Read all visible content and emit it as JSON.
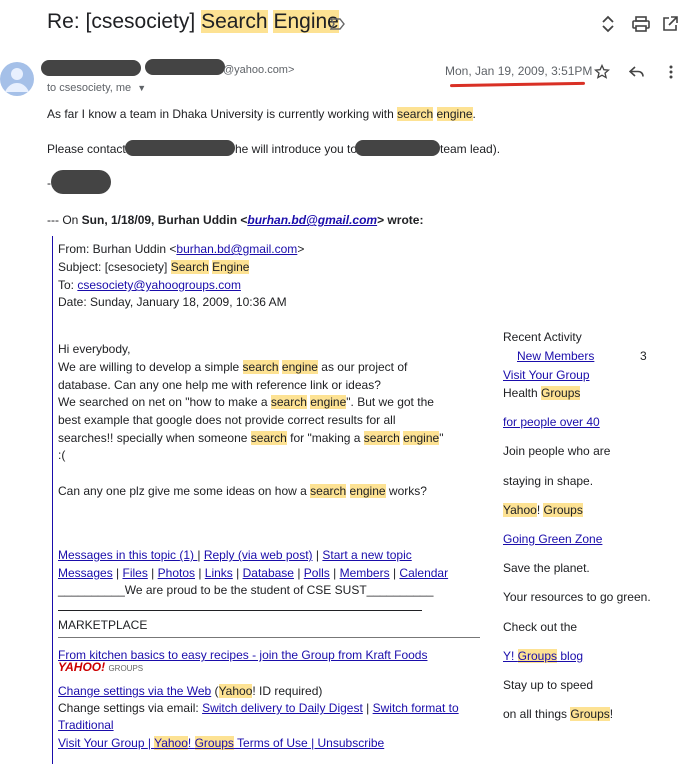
{
  "header": {
    "subject_prefix": "Re: [csesociety] ",
    "subject_hl1": "Search",
    "subject_hl2": "Engine"
  },
  "sender": {
    "email_suffix": "@yahoo.com>",
    "to_line": "to csesociety, me",
    "date": "Mon, Jan 19, 2009, 3:51PM"
  },
  "body": {
    "l1_pre": "As far I know a team in Dhaka University is currently working with ",
    "l1_hl1": "search",
    "l1_hl2": "engine",
    "l1_post": ".",
    "l2_a": "Please contact",
    "l2_b": "he will introduce you to",
    "l2_c": "team lead).",
    "sig": "-",
    "on_line_pre": "--- On ",
    "on_line_date": "Sun, 1/18/09, Burhan Uddin <",
    "on_line_email": "burhan.bd@gmail.com",
    "on_line_post": "> wrote:"
  },
  "quoted": {
    "from_pre": "From: Burhan Uddin <",
    "from_email": "burhan.bd@gmail.com",
    "from_post": ">",
    "subject_pre": "Subject: [csesociety] ",
    "subject_hl1": "Search",
    "subject_hl2": "Engine",
    "to_pre": "To: ",
    "to_email": "csesociety@yahoogroups.com",
    "date": "Date: Sunday, January 18, 2009, 10:36 AM",
    "p1": "Hi everybody,",
    "p2_pre": "We are willing to develop a simple ",
    "p2_hl1": "search",
    "p2_hl2": "engine",
    "p2_post": " as our project of",
    "p3": "database. Can any one help me with reference link or ideas?",
    "p4_pre": "We searched on net on \"how to make a ",
    "p4_hl1": "search",
    "p4_hl2": "engine",
    "p4_post": "\". But we got the",
    "p5": "best example that google does not provide correct results for all",
    "p6_pre": "searches!! specially when someone ",
    "p6_hl1": "search",
    "p6_mid": " for \"making a ",
    "p6_hl2": "search",
    "p6_hl3": "engine",
    "p6_post": "\"",
    "p7": ":(",
    "p8_pre": "Can any one plz give me some ideas on how a ",
    "p8_hl1": "search",
    "p8_hl2": "engine",
    "p8_post": " works?",
    "links1_a": "Messages in this topic ",
    "links1_b": "(1) ",
    "links1_c": "Reply (via web post)",
    "links1_d": " | ",
    "links1_e": "Start a new topic",
    "links2": [
      "Messages",
      "Files",
      "Photos",
      "Links",
      "Database",
      "Polls",
      "Members",
      "Calendar"
    ],
    "proud": "__________We are proud to be the student of CSE SUST__________",
    "marketplace": "MARKETPLACE",
    "kraft": "From kitchen basics to easy recipes - join the Group from Kraft Foods",
    "yahoo_logo": "YAHOO!",
    "yahoo_groups_logo": "GROUPS",
    "change_web": "Change settings via the Web",
    "change_web_post1": " (",
    "change_web_hl": "Yahoo",
    "change_web_post2": "! ID required)",
    "change_email_pre": "Change settings via email: ",
    "switch_daily": "Switch delivery to Daily Digest",
    "switch_sep": " | ",
    "switch_format": "Switch format to",
    "traditional": "Traditional",
    "bottom_visit": "Visit Your Group ",
    "bottom_sep1": "| ",
    "bottom_yahoo": "Yahoo",
    "bottom_excl": "! ",
    "bottom_groups": "Groups",
    "bottom_terms": " Terms of Use ",
    "bottom_sep2": "| ",
    "bottom_unsub": "Unsubscribe"
  },
  "sidebar": {
    "recent": "Recent Activity",
    "new_members": "New Members",
    "count": "3",
    "visit": "Visit Your Group",
    "health_pre": "Health ",
    "health_hl": "Groups",
    "for_people": "for people over 40",
    "join1": "Join people who are",
    "join2": "staying in shape.",
    "yg_hl1": "Yahoo",
    "yg_mid": "! ",
    "yg_hl2": "Groups",
    "green": "Going Green Zone",
    "save": "Save the planet.",
    "resources": "Your resources to go green.",
    "check": "Check out the",
    "y_pre": "Y! ",
    "y_hl": "Groups",
    "y_post": " blog",
    "stay": "Stay up to speed",
    "on_all_pre": "on all things ",
    "on_all_hl": "Groups",
    "on_all_post": "!"
  },
  "icons": [
    "label-icon",
    "expand-icon",
    "print-icon",
    "open-new-icon",
    "avatar",
    "dropdown-icon",
    "star-icon",
    "reply-icon",
    "more-icon"
  ],
  "colors": {
    "highlight": "#fde293",
    "link": "#1a0dab",
    "redaction": "#444444",
    "underline_red": "#d93025"
  }
}
